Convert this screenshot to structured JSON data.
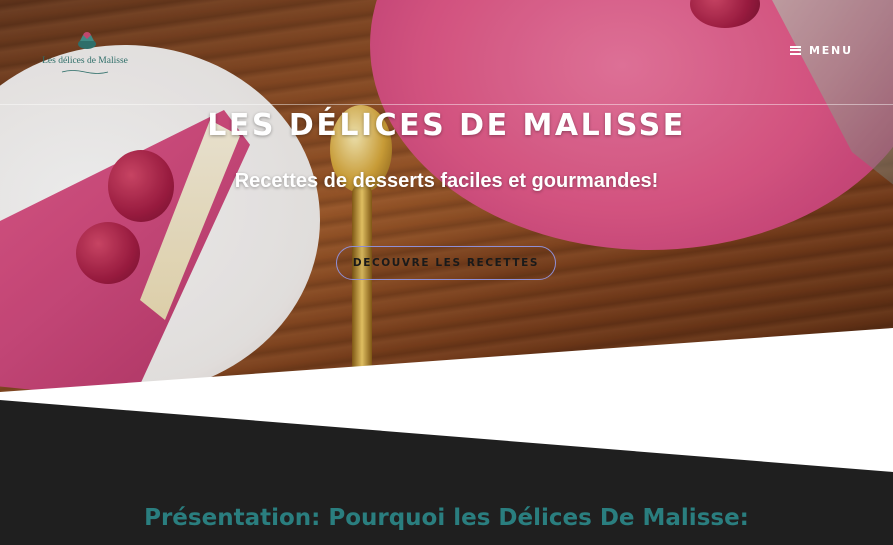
{
  "header": {
    "logo_text": "Les délices de Malisse",
    "menu_label": "MENU"
  },
  "hero": {
    "title": "LES DÉLICES DE MALISSE",
    "subtitle": "Recettes de desserts faciles et gourmandes!",
    "cta_label": "DECOUVRE LES RECETTES"
  },
  "section": {
    "title": "Présentation: Pourquoi les Délices De Malisse:"
  },
  "colors": {
    "dark_section": "#1f1f1f",
    "section_title": "#2a7e7f",
    "cta_border": "#8f8fd6",
    "logo_text": "#2e6e69"
  },
  "icons": {
    "menu": "hamburger-icon",
    "logo_crown": "crown-icon"
  }
}
